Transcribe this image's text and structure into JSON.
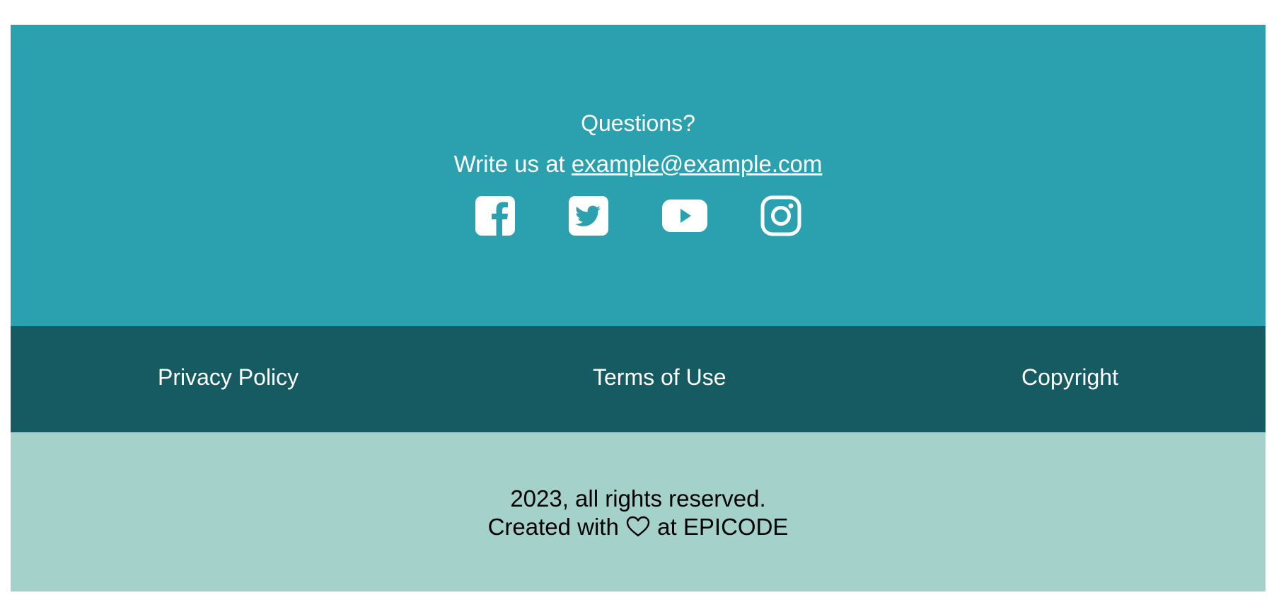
{
  "contact": {
    "title": "Questions?",
    "write_prefix": "Write us at ",
    "email": "example@example.com"
  },
  "social": [
    {
      "name": "facebook-icon"
    },
    {
      "name": "twitter-icon"
    },
    {
      "name": "youtube-icon"
    },
    {
      "name": "instagram-icon"
    }
  ],
  "links": {
    "privacy": "Privacy Policy",
    "terms": "Terms of Use",
    "copyright": "Copyright"
  },
  "bottom": {
    "rights": "2023, all rights reserved.",
    "created_prefix": "Created with ",
    "created_suffix": " at EPICODE"
  },
  "colors": {
    "contact_bg": "#2ba1b0",
    "links_bg": "#155b61",
    "bottom_bg": "#a4d2cb"
  }
}
